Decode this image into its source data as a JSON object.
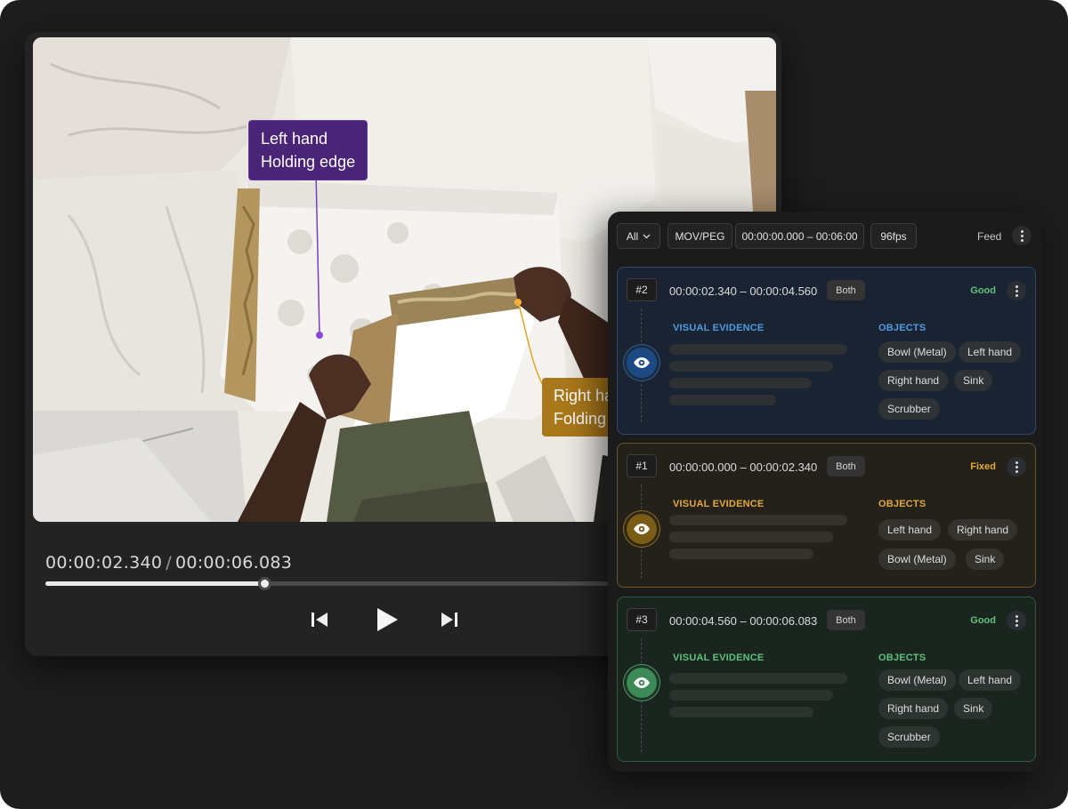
{
  "player": {
    "current_time": "00:00:02.340",
    "separator": "/",
    "duration": "00:00:06.083",
    "progress_fraction": 0.385,
    "controls": {
      "previous": "skip-previous-icon",
      "play": "play-icon",
      "next": "skip-next-icon"
    },
    "callouts": {
      "left": {
        "line1": "Left hand",
        "line2": "Holding edge",
        "color": "#4a2476"
      },
      "right": {
        "line1": "Right hand",
        "line2": "Folding",
        "color": "#a9781a"
      }
    }
  },
  "panel": {
    "filter": {
      "label": "All",
      "icon": "chevron-down-icon"
    },
    "format": "MOV/PEG",
    "range": "00:00:00.000 – 00:06:00",
    "fps": "96fps",
    "feed_label": "Feed",
    "section_labels": {
      "visual_evidence": "VISUAL EVIDENCE",
      "objects": "OBJECTS"
    },
    "segments": [
      {
        "index": "#2",
        "range": "00:00:02.340 – 00:00:04.560",
        "hands": "Both",
        "status": "Good",
        "accent": "#4f9be0",
        "objects": [
          "Bowl (Metal)",
          "Left hand",
          "Right hand",
          "Sink",
          "Scrubber"
        ]
      },
      {
        "index": "#1",
        "range": "00:00:00.000 – 00:00:02.340",
        "hands": "Both",
        "status": "Fixed",
        "accent": "#e2a93b",
        "objects": [
          "Left hand",
          "Right hand",
          "Bowl (Metal)",
          "Sink"
        ]
      },
      {
        "index": "#3",
        "range": "00:00:04.560 – 00:00:06.083",
        "hands": "Both",
        "status": "Good",
        "accent": "#5dc27b",
        "objects": [
          "Bowl (Metal)",
          "Left hand",
          "Right hand",
          "Sink",
          "Scrubber"
        ]
      }
    ]
  }
}
